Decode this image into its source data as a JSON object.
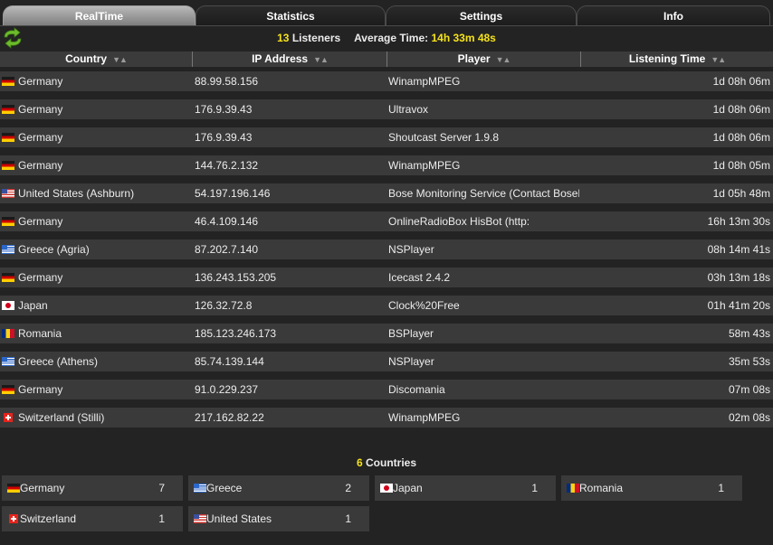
{
  "tabs": [
    "RealTime",
    "Statistics",
    "Settings",
    "Info"
  ],
  "active_tab": 0,
  "summary": {
    "listeners_count": "13",
    "listeners_label": "Listeners",
    "avg_label": "Average Time:",
    "avg_value": "14h 33m 48s"
  },
  "table": {
    "headers": [
      "Country",
      "IP Address",
      "Player",
      "Listening Time"
    ],
    "rows": [
      {
        "flag": "de",
        "country": "Germany",
        "ip": "88.99.58.156",
        "player": "WinampMPEG",
        "time": "1d 08h 06m"
      },
      {
        "flag": "de",
        "country": "Germany",
        "ip": "176.9.39.43",
        "player": "Ultravox",
        "time": "1d 08h 06m"
      },
      {
        "flag": "de",
        "country": "Germany",
        "ip": "176.9.39.43",
        "player": "Shoutcast Server 1.9.8",
        "time": "1d 08h 06m"
      },
      {
        "flag": "de",
        "country": "Germany",
        "ip": "144.76.2.132",
        "player": "WinampMPEG",
        "time": "1d 08h 05m"
      },
      {
        "flag": "us",
        "country": "United States (Ashburn)",
        "ip": "54.197.196.146",
        "player": "Bose Monitoring Service (Contact BoseM",
        "time": "1d 05h 48m"
      },
      {
        "flag": "de",
        "country": "Germany",
        "ip": "46.4.109.146",
        "player": "OnlineRadioBox HisBot (http:",
        "time": "16h 13m 30s"
      },
      {
        "flag": "gr",
        "country": "Greece (Agria)",
        "ip": "87.202.7.140",
        "player": "NSPlayer",
        "time": "08h 14m 41s"
      },
      {
        "flag": "de",
        "country": "Germany",
        "ip": "136.243.153.205",
        "player": "Icecast 2.4.2",
        "time": "03h 13m 18s"
      },
      {
        "flag": "jp",
        "country": "Japan",
        "ip": "126.32.72.8",
        "player": "Clock%20Free",
        "time": "01h 41m 20s"
      },
      {
        "flag": "ro",
        "country": "Romania",
        "ip": "185.123.246.173",
        "player": "BSPlayer",
        "time": "58m 43s"
      },
      {
        "flag": "gr",
        "country": "Greece (Athens)",
        "ip": "85.74.139.144",
        "player": "NSPlayer",
        "time": "35m 53s"
      },
      {
        "flag": "de",
        "country": "Germany",
        "ip": "91.0.229.237",
        "player": "Discomania",
        "time": "07m 08s"
      },
      {
        "flag": "ch",
        "country": "Switzerland (Stilli)",
        "ip": "217.162.82.22",
        "player": "WinampMPEG",
        "time": "02m 08s"
      }
    ]
  },
  "countries": {
    "count": "6",
    "label": "Countries",
    "items": [
      {
        "flag": "de",
        "name": "Germany",
        "count": "7"
      },
      {
        "flag": "gr",
        "name": "Greece",
        "count": "2"
      },
      {
        "flag": "jp",
        "name": "Japan",
        "count": "1"
      },
      {
        "flag": "ro",
        "name": "Romania",
        "count": "1"
      },
      {
        "flag": "ch",
        "name": "Switzerland",
        "count": "1"
      },
      {
        "flag": "us",
        "name": "United States",
        "count": "1"
      }
    ]
  },
  "colors": {
    "accent_yellow": "#f5e21b",
    "row_bg": "#3a3a3a",
    "page_bg": "#232323"
  },
  "icons": {
    "refresh": "refresh-icon",
    "sort": "sort-arrows-icon"
  }
}
